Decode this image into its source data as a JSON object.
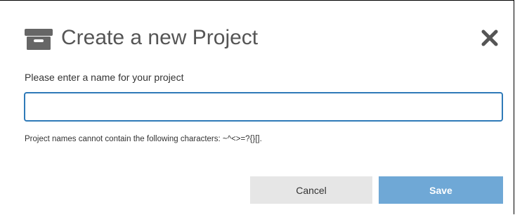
{
  "dialog": {
    "title": "Create a new Project",
    "title_icon": "archive-box-icon",
    "close_icon": "close-icon",
    "prompt_label": "Please enter a name for your project",
    "name_input": {
      "value": "",
      "placeholder": ""
    },
    "hint": "Project names cannot contain the following characters: ~^<>=?{}[].",
    "buttons": {
      "cancel_label": "Cancel",
      "save_label": "Save"
    }
  },
  "colors": {
    "input_border": "#2f7ab8",
    "save_button": "#6fa8d6",
    "cancel_button": "#e6e6e6",
    "title_text": "#555555"
  }
}
